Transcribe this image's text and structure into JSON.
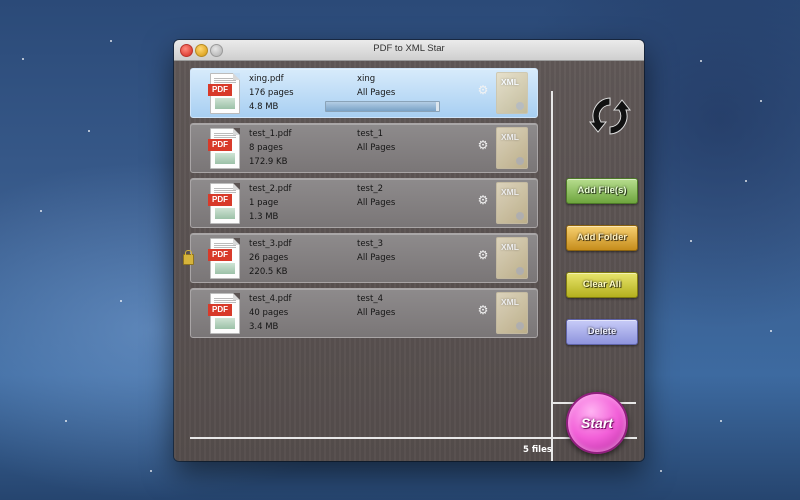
{
  "window": {
    "title": "PDF to XML Star"
  },
  "files": [
    {
      "name": "xing.pdf",
      "pages": "176 pages",
      "size": "4.8 MB",
      "output_name": "xing",
      "page_range": "All Pages",
      "selected": true,
      "locked": false,
      "progress": 0.97
    },
    {
      "name": "test_1.pdf",
      "pages": "8 pages",
      "size": "172.9 KB",
      "output_name": "test_1",
      "page_range": "All Pages",
      "selected": false,
      "locked": false
    },
    {
      "name": "test_2.pdf",
      "pages": "1 page",
      "size": "1.3 MB",
      "output_name": "test_2",
      "page_range": "All Pages",
      "selected": false,
      "locked": false
    },
    {
      "name": "test_3.pdf",
      "pages": "26 pages",
      "size": "220.5 KB",
      "output_name": "test_3",
      "page_range": "All Pages",
      "selected": false,
      "locked": true
    },
    {
      "name": "test_4.pdf",
      "pages": "40 pages",
      "size": "3.4 MB",
      "output_name": "test_4",
      "page_range": "All Pages",
      "selected": false,
      "locked": false
    }
  ],
  "icons": {
    "pdf_label": "PDF",
    "xml_label": "XML",
    "gear": "gear-icon",
    "refresh": "refresh-icon",
    "lock": "lock-icon"
  },
  "buttons": {
    "add_files": "Add File(s)",
    "add_folder": "Add Folder",
    "clear_all": "Clear All",
    "delete": "Delete",
    "start": "Start"
  },
  "status": {
    "file_count": "5 files"
  },
  "colors": {
    "add_files": "#6ea53e",
    "add_folder": "#c68d1c",
    "clear_all": "#b4b01e",
    "delete": "#8e94dd",
    "start": "#f25fd8",
    "selected_row": "#a8cff2"
  }
}
